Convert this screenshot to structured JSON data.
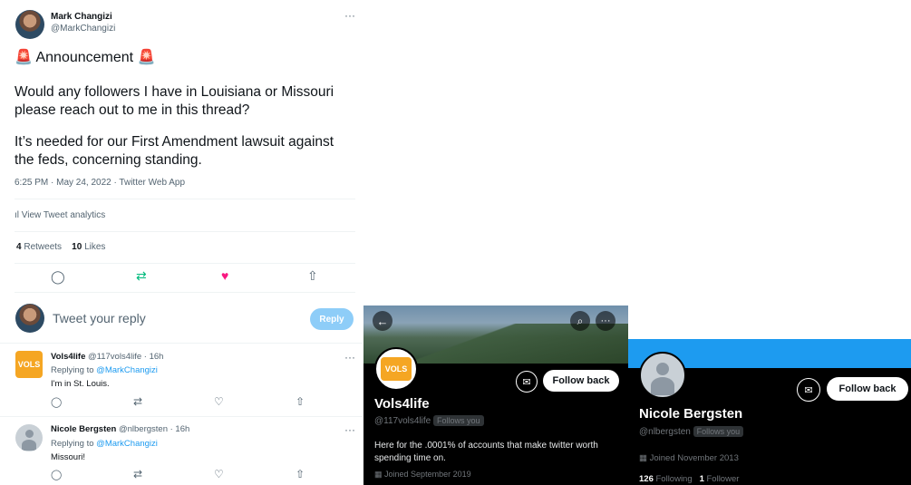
{
  "tweet": {
    "author_name": "Mark Changizi",
    "author_handle": "@MarkChangizi",
    "more": "···",
    "announcement_text": "Announcement",
    "siren_icon": "🚨",
    "body_p1": "Would any followers I have in Louisiana or Missouri please reach out to me in this thread?",
    "body_p2": "It’s needed for our First Amendment lawsuit against the feds, concerning standing.",
    "timestamp": "6:25 PM · May 24, 2022 · Twitter Web App",
    "analytics": "View Tweet analytics",
    "retweets_count": "4",
    "retweets_label": "Retweets",
    "likes_count": "10",
    "likes_label": "Likes"
  },
  "reply_box": {
    "placeholder": "Tweet your reply",
    "button": "Reply"
  },
  "replies": [
    {
      "name": "Vols4life",
      "meta": "@117vols4life · 16h",
      "replying_label": "Replying to",
      "replying_handle": "@MarkChangizi",
      "text": "I'm in St. Louis.",
      "logo_text": "VOLS"
    },
    {
      "name": "Nicole Bergsten",
      "meta": "@nlbergsten · 16h",
      "replying_label": "Replying to",
      "replying_handle": "@MarkChangizi",
      "text": "Missouri!"
    }
  ],
  "profile_vols": {
    "name": "Vols4life",
    "handle": "@117vols4life",
    "follows_you": "Follows you",
    "bio": "Here for the .0001% of accounts that make twitter worth spending time on.",
    "joined": "Joined September 2019",
    "follow_button": "Follow back",
    "logo_text": "VOLS"
  },
  "profile_nicole": {
    "name": "Nicole Bergsten",
    "handle": "@nlbergsten",
    "follows_you": "Follows you",
    "joined": "Joined November 2013",
    "following_count": "126",
    "following_label": "Following",
    "followers_count": "1",
    "followers_label": "Follower",
    "follow_button": "Follow back"
  },
  "icons": {
    "reply": "reply-icon",
    "retweet": "retweet-icon",
    "like": "heart-icon",
    "share": "share-icon",
    "mail": "mail-icon",
    "calendar": "calendar-icon"
  },
  "colors": {
    "accent": "#1d9bf0",
    "retweet": "#00ba7c",
    "like": "#f91880",
    "reply_disabled": "#8ecdf8"
  }
}
